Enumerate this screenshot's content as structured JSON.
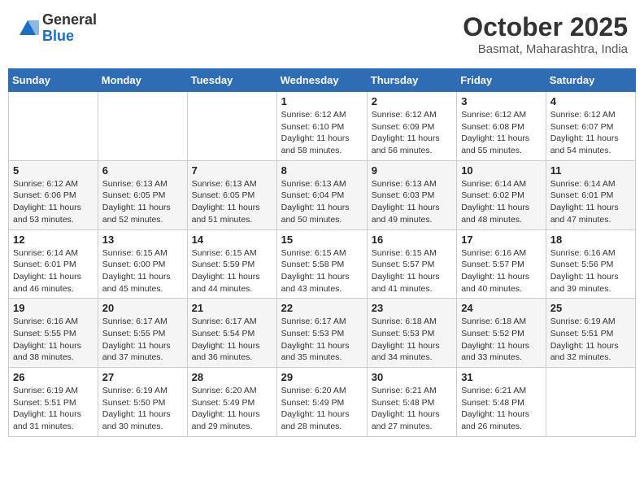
{
  "header": {
    "logo_general": "General",
    "logo_blue": "Blue",
    "month_title": "October 2025",
    "location": "Basmat, Maharashtra, India"
  },
  "weekdays": [
    "Sunday",
    "Monday",
    "Tuesday",
    "Wednesday",
    "Thursday",
    "Friday",
    "Saturday"
  ],
  "weeks": [
    [
      {
        "day": "",
        "info": ""
      },
      {
        "day": "",
        "info": ""
      },
      {
        "day": "",
        "info": ""
      },
      {
        "day": "1",
        "info": "Sunrise: 6:12 AM\nSunset: 6:10 PM\nDaylight: 11 hours\nand 58 minutes."
      },
      {
        "day": "2",
        "info": "Sunrise: 6:12 AM\nSunset: 6:09 PM\nDaylight: 11 hours\nand 56 minutes."
      },
      {
        "day": "3",
        "info": "Sunrise: 6:12 AM\nSunset: 6:08 PM\nDaylight: 11 hours\nand 55 minutes."
      },
      {
        "day": "4",
        "info": "Sunrise: 6:12 AM\nSunset: 6:07 PM\nDaylight: 11 hours\nand 54 minutes."
      }
    ],
    [
      {
        "day": "5",
        "info": "Sunrise: 6:12 AM\nSunset: 6:06 PM\nDaylight: 11 hours\nand 53 minutes."
      },
      {
        "day": "6",
        "info": "Sunrise: 6:13 AM\nSunset: 6:05 PM\nDaylight: 11 hours\nand 52 minutes."
      },
      {
        "day": "7",
        "info": "Sunrise: 6:13 AM\nSunset: 6:05 PM\nDaylight: 11 hours\nand 51 minutes."
      },
      {
        "day": "8",
        "info": "Sunrise: 6:13 AM\nSunset: 6:04 PM\nDaylight: 11 hours\nand 50 minutes."
      },
      {
        "day": "9",
        "info": "Sunrise: 6:13 AM\nSunset: 6:03 PM\nDaylight: 11 hours\nand 49 minutes."
      },
      {
        "day": "10",
        "info": "Sunrise: 6:14 AM\nSunset: 6:02 PM\nDaylight: 11 hours\nand 48 minutes."
      },
      {
        "day": "11",
        "info": "Sunrise: 6:14 AM\nSunset: 6:01 PM\nDaylight: 11 hours\nand 47 minutes."
      }
    ],
    [
      {
        "day": "12",
        "info": "Sunrise: 6:14 AM\nSunset: 6:01 PM\nDaylight: 11 hours\nand 46 minutes."
      },
      {
        "day": "13",
        "info": "Sunrise: 6:15 AM\nSunset: 6:00 PM\nDaylight: 11 hours\nand 45 minutes."
      },
      {
        "day": "14",
        "info": "Sunrise: 6:15 AM\nSunset: 5:59 PM\nDaylight: 11 hours\nand 44 minutes."
      },
      {
        "day": "15",
        "info": "Sunrise: 6:15 AM\nSunset: 5:58 PM\nDaylight: 11 hours\nand 43 minutes."
      },
      {
        "day": "16",
        "info": "Sunrise: 6:15 AM\nSunset: 5:57 PM\nDaylight: 11 hours\nand 41 minutes."
      },
      {
        "day": "17",
        "info": "Sunrise: 6:16 AM\nSunset: 5:57 PM\nDaylight: 11 hours\nand 40 minutes."
      },
      {
        "day": "18",
        "info": "Sunrise: 6:16 AM\nSunset: 5:56 PM\nDaylight: 11 hours\nand 39 minutes."
      }
    ],
    [
      {
        "day": "19",
        "info": "Sunrise: 6:16 AM\nSunset: 5:55 PM\nDaylight: 11 hours\nand 38 minutes."
      },
      {
        "day": "20",
        "info": "Sunrise: 6:17 AM\nSunset: 5:55 PM\nDaylight: 11 hours\nand 37 minutes."
      },
      {
        "day": "21",
        "info": "Sunrise: 6:17 AM\nSunset: 5:54 PM\nDaylight: 11 hours\nand 36 minutes."
      },
      {
        "day": "22",
        "info": "Sunrise: 6:17 AM\nSunset: 5:53 PM\nDaylight: 11 hours\nand 35 minutes."
      },
      {
        "day": "23",
        "info": "Sunrise: 6:18 AM\nSunset: 5:53 PM\nDaylight: 11 hours\nand 34 minutes."
      },
      {
        "day": "24",
        "info": "Sunrise: 6:18 AM\nSunset: 5:52 PM\nDaylight: 11 hours\nand 33 minutes."
      },
      {
        "day": "25",
        "info": "Sunrise: 6:19 AM\nSunset: 5:51 PM\nDaylight: 11 hours\nand 32 minutes."
      }
    ],
    [
      {
        "day": "26",
        "info": "Sunrise: 6:19 AM\nSunset: 5:51 PM\nDaylight: 11 hours\nand 31 minutes."
      },
      {
        "day": "27",
        "info": "Sunrise: 6:19 AM\nSunset: 5:50 PM\nDaylight: 11 hours\nand 30 minutes."
      },
      {
        "day": "28",
        "info": "Sunrise: 6:20 AM\nSunset: 5:49 PM\nDaylight: 11 hours\nand 29 minutes."
      },
      {
        "day": "29",
        "info": "Sunrise: 6:20 AM\nSunset: 5:49 PM\nDaylight: 11 hours\nand 28 minutes."
      },
      {
        "day": "30",
        "info": "Sunrise: 6:21 AM\nSunset: 5:48 PM\nDaylight: 11 hours\nand 27 minutes."
      },
      {
        "day": "31",
        "info": "Sunrise: 6:21 AM\nSunset: 5:48 PM\nDaylight: 11 hours\nand 26 minutes."
      },
      {
        "day": "",
        "info": ""
      }
    ]
  ]
}
